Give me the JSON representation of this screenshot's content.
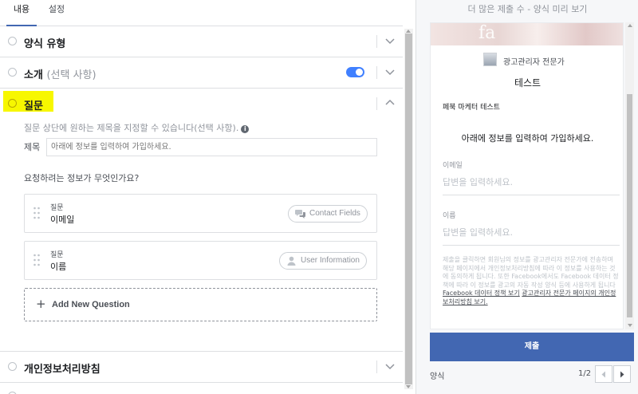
{
  "tabs": [
    {
      "label": "내용",
      "active": true
    },
    {
      "label": "설정",
      "active": false
    }
  ],
  "sections": {
    "form_type": {
      "title": "양식 유형"
    },
    "intro": {
      "title": "소개",
      "optional": "(선택 사항)",
      "toggle_on": true
    },
    "questions": {
      "title": "질문",
      "help_text": "질문 상단에 원하는 제목을 지정할 수 있습니다(선택 사항).",
      "info_icon": "i",
      "title_label": "제목",
      "title_value": "아래에 정보를 입력하여 가입하세요.",
      "prompt": "요청하려는 정보가 무엇인가요?",
      "items": [
        {
          "label": "질문",
          "value": "이메일",
          "pill": "Contact Fields",
          "pill_icon": "chat-bubbles-icon"
        },
        {
          "label": "질문",
          "value": "이름",
          "pill": "User Information",
          "pill_icon": "person-icon"
        }
      ],
      "add_label": "Add New Question",
      "add_icon": "+"
    },
    "privacy": {
      "title": "개인정보처리방침"
    }
  },
  "preview": {
    "header": "더 많은 제출 수 - 양식 미리 보기",
    "cover_text": "fa",
    "business_name": "광고관리자 전문가",
    "form_title": "테스트",
    "headline": "페북 마케터 테스트",
    "intro_text": "아래에 정보를 입력하여 가입하세요.",
    "fields": [
      {
        "label": "이메일",
        "placeholder": "답변을 입력하세요."
      },
      {
        "label": "이름",
        "placeholder": "답변을 입력하세요."
      }
    ],
    "disclaimer_text": "제출을 클릭하면 회원님의 정보를 광고관리자 전문가에 전송하며 해당 페이지에서 개인정보처리방침에 따라 이 정보를 사용하는 것에 동의하게 됩니다. 또한 Facebook에서도 Facebook 데이터 정책에 따라 이 정보를 광고의 자동 작성 양식 등에 사용하게 됩니다 ",
    "disclaimer_link1": "Facebook 데이터 정책 보기",
    "disclaimer_link2": "광고관리자 전문가 페이지의 개인정보처리방침 보기.",
    "submit_label": "제출",
    "footer_label": "양식",
    "page_indicator": "1/2"
  },
  "colors": {
    "accent": "#4267b2",
    "toggle": "#4080ff",
    "highlight": "#f7f700"
  }
}
